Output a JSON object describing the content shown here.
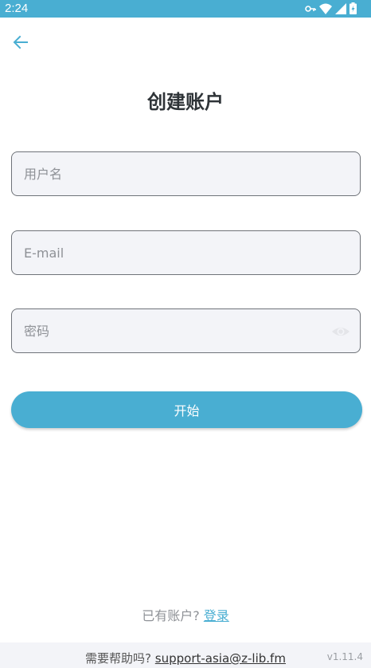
{
  "status_bar": {
    "time": "2:24",
    "icons": [
      "key-icon",
      "wifi-icon",
      "signal-icon",
      "battery-icon"
    ]
  },
  "header": {
    "back_icon": "arrow-left-icon"
  },
  "title": "创建账户",
  "form": {
    "username": {
      "value": "",
      "placeholder": "用户名"
    },
    "email": {
      "value": "",
      "placeholder": "E-mail"
    },
    "password": {
      "value": "",
      "placeholder": "密码",
      "toggle_icon": "eye-icon"
    },
    "submit_label": "开始"
  },
  "login_prompt": {
    "text": "已有账户?",
    "link": "登录"
  },
  "footer": {
    "help_text": "需要帮助吗?",
    "email": "support-asia@z-lib.fm",
    "version": "v1.11.4"
  },
  "colors": {
    "accent": "#49aed2",
    "field_bg": "#f3f4f8",
    "title": "#2f3438"
  }
}
